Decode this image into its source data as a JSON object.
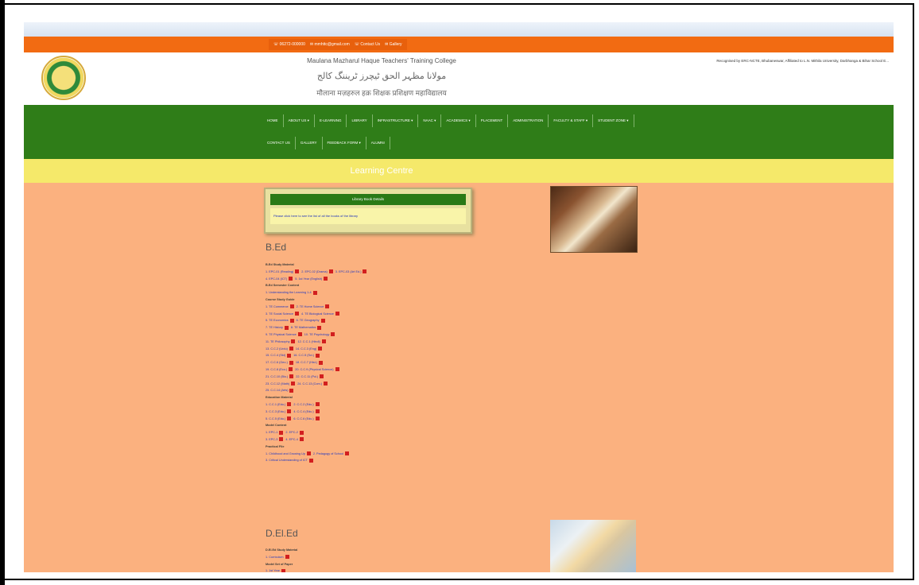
{
  "header": {
    "title_en": "Maulana Mazharul Haque Teachers' Training College",
    "title_ur": "مولانا مظہر الحق ٹیچرز ٹریننگ کالج",
    "title_hi": "मौलाना मज़हरुल हक़ शिक्षक प्रशिक्षण महाविद्यालय",
    "recognition": "Recognised by ERC-NCTE, Bhubaneswar, Affiliated to L.N. Mithila University, Darbhanga & Bihar School E..."
  },
  "topbar": {
    "phone": "☏ 06272-000000",
    "email": "✉ mmhttc@gmail.com",
    "contact": "☏ Contact Us",
    "gallery": "✉ Gallery"
  },
  "nav": {
    "row1": [
      "HOME",
      "ABOUT US ▾",
      "E-LEARNING",
      "LIBRARY",
      "INFRASTRUCTURE ▾",
      "NAAC ▾",
      "ACADEMICS ▾",
      "PLACEMENT",
      "ADMINISTRATION",
      "FACULTY & STAFF ▾",
      "STUDENT ZONE ▾"
    ],
    "row2": [
      "CONTACT US",
      "GALLERY",
      "FEEDBACK FORM ▾",
      "ALUMNI"
    ]
  },
  "banner": "Learning Centre",
  "notice": {
    "head": "Library Book Details",
    "body": "Please click here to see the list of all the books of the library"
  },
  "bed": {
    "title": "B.Ed",
    "lines": [
      {
        "t": "head",
        "text": "B.Ed Study Material"
      },
      {
        "t": "link",
        "items": [
          "1. EPC-01 (Reading)",
          "2. EPC-02 (Drama)",
          "3. EPC-03 (Art Ed.)"
        ]
      },
      {
        "t": "link",
        "items": [
          "4. EPC-04 (ICT)",
          "5. 1st Year (English)"
        ]
      },
      {
        "t": "head",
        "text": "B.Ed Semester Content"
      },
      {
        "t": "link",
        "items": [
          "1. Understanding the Learning 1-4"
        ]
      },
      {
        "t": "head",
        "text": "Course Study Guide"
      },
      {
        "t": "link",
        "items": [
          "1. TE Commerce",
          "2. TE Home Science"
        ]
      },
      {
        "t": "link",
        "items": [
          "3. TE Social Science",
          "4. TE Biological Science"
        ]
      },
      {
        "t": "link",
        "items": [
          "5. TE Economics",
          "6. TE Geography"
        ]
      },
      {
        "t": "link",
        "items": [
          "7. TE History",
          "8. TE Mathematics"
        ]
      },
      {
        "t": "link",
        "items": [
          "9. TE Physical Science",
          "10. TE Psychology"
        ]
      },
      {
        "t": "link",
        "items": [
          "11. TE Philosophy",
          "12. C.C.1 (Hindi)"
        ]
      },
      {
        "t": "link",
        "items": [
          "13. C.C.2 (Urdu)",
          "14. C.C.3 (Eng)"
        ]
      },
      {
        "t": "link",
        "items": [
          "15. C.C.4 (Skt)",
          "16. C.C.5 (Sci.)"
        ]
      },
      {
        "t": "link",
        "items": [
          "17. C.C.6 (Geo.)",
          "18. C.C.7 (Hist.)"
        ]
      },
      {
        "t": "link",
        "items": [
          "19. C.C.8 (Eco.)",
          "20. C.C.9 (Physical Science)"
        ]
      },
      {
        "t": "link",
        "items": [
          "21. C.C.10 (Bio.)",
          "22. C.C.11 (Pol.)"
        ]
      },
      {
        "t": "link",
        "items": [
          "23. C.C.12 (Math)",
          "24. C.C.13 (Com.)"
        ]
      },
      {
        "t": "link",
        "items": [
          "25. C.C.14 (Arts)"
        ]
      },
      {
        "t": "head",
        "text": "Education Material"
      },
      {
        "t": "link",
        "items": [
          "1. C.C.1 (Edu.)",
          "2. C.C.2 (Edu.)"
        ]
      },
      {
        "t": "link",
        "items": [
          "3. C.C.3 (Edu.)",
          "4. C.C.4 (Edu.)"
        ]
      },
      {
        "t": "link",
        "items": [
          "5. C.C.5 (Edu.)",
          "6. C.C.6 (Edu.)"
        ]
      },
      {
        "t": "head",
        "text": "Model Content"
      },
      {
        "t": "link",
        "items": [
          "1. EPC-1",
          "2. EPC-2"
        ]
      },
      {
        "t": "link",
        "items": [
          "3. EPC-3",
          "4. EPC-4"
        ]
      },
      {
        "t": "head",
        "text": "Practical File"
      },
      {
        "t": "link",
        "items": [
          "1. Childhood and Growing Up",
          "2. Pedagogy of School"
        ]
      },
      {
        "t": "link",
        "items": [
          "3. Critical Understanding of ICT"
        ]
      }
    ]
  },
  "deled": {
    "title": "D.El.Ed",
    "lines": [
      {
        "t": "head",
        "text": "D.El.Ed Study Material"
      },
      {
        "t": "link",
        "items": [
          "1. Curriculum"
        ]
      },
      {
        "t": "head",
        "text": "Model Set of Paper"
      },
      {
        "t": "link",
        "items": [
          "1. 1st Year"
        ]
      }
    ]
  }
}
